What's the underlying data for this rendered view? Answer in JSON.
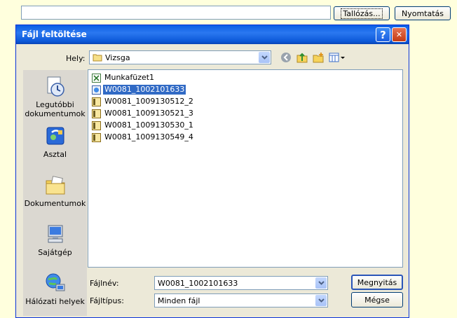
{
  "top": {
    "browse_label": "Tallózás...",
    "print_label": "Nyomtatás"
  },
  "dialog": {
    "title": "Fájl feltöltése",
    "help_glyph": "?",
    "close_glyph": "✕",
    "lookin_label": "Hely:",
    "lookin_value": "Vizsga",
    "places": [
      {
        "label": "Legutóbbi dokumentumok",
        "icon": "recent-documents-icon"
      },
      {
        "label": "Asztal",
        "icon": "desktop-icon"
      },
      {
        "label": "Dokumentumok",
        "icon": "my-documents-icon"
      },
      {
        "label": "Sajátgép",
        "icon": "my-computer-icon"
      },
      {
        "label": "Hálózati helyek",
        "icon": "network-places-icon"
      }
    ],
    "files": [
      {
        "name": "Munkafüzet1",
        "icon": "excel-file-icon"
      },
      {
        "name": "W0081_1002101633",
        "icon": "web-file-icon",
        "selected": true
      },
      {
        "name": "W0081_1009130512_2",
        "icon": "folder-file-icon"
      },
      {
        "name": "W0081_1009130521_3",
        "icon": "folder-file-icon"
      },
      {
        "name": "W0081_1009130530_1",
        "icon": "folder-file-icon"
      },
      {
        "name": "W0081_1009130549_4",
        "icon": "folder-file-icon"
      }
    ],
    "filename_label": "Fájlnév:",
    "filename_value": "W0081_1002101633",
    "filetype_label": "Fájltípus:",
    "filetype_value": "Minden fájl",
    "open_label": "Megnyitás",
    "cancel_label": "Mégse"
  },
  "colors": {
    "page_background": "#ffffdd",
    "titlebar": "#0a5fe4",
    "selection": "#316ac5"
  }
}
